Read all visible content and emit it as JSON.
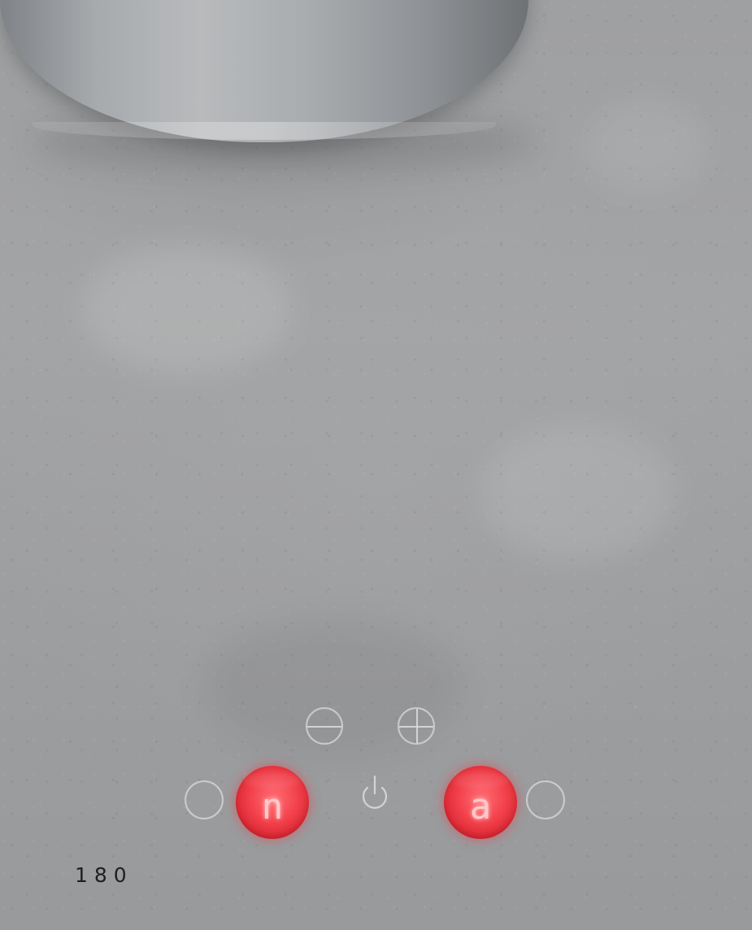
{
  "scene": {
    "surface_color": "#9fa0a2",
    "pot_color": "#a7aaad",
    "display_color": "#f3424c"
  },
  "cooktop_controls": {
    "minus_icon": "minus-circle-icon",
    "plus_icon": "plus-circle-icon",
    "power_icon": "power-icon",
    "left_display": {
      "value": "n"
    },
    "right_display": {
      "value": "a"
    }
  },
  "page_number": "180"
}
